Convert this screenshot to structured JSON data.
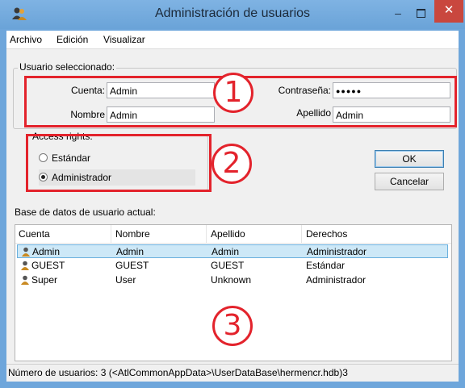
{
  "window": {
    "title": "Administración de usuarios",
    "minimize_glyph": "–",
    "close_glyph": "✕",
    "icon": "users-app-icon"
  },
  "menu": [
    "Archivo",
    "Edición",
    "Visualizar"
  ],
  "selected_user": {
    "legend": "Usuario seleccionado:",
    "account_label": "Cuenta:",
    "account_value": "Admin",
    "name_label": "Nombre",
    "name_value": "Admin",
    "password_label": "Contraseña:",
    "password_value": "●●●●●",
    "surname_label": "Apellido",
    "surname_value": "Admin"
  },
  "access_rights": {
    "legend": "Access rights:",
    "options": [
      "Estándar",
      "Administrador"
    ],
    "selected_index": 1
  },
  "buttons": {
    "ok": "OK",
    "cancel": "Cancelar"
  },
  "database": {
    "label": "Base de datos de usuario actual:",
    "columns": [
      "Cuenta",
      "Nombre",
      "Apellido",
      "Derechos"
    ],
    "rows": [
      [
        "Admin",
        "Admin",
        "Admin",
        "Administrador"
      ],
      [
        "GUEST",
        "GUEST",
        "GUEST",
        "Estándar"
      ],
      [
        "Super",
        "User",
        "Unknown",
        "Administrador"
      ]
    ],
    "selected_row": 0
  },
  "status": "Número de usuarios: 3  (<AtlCommonAppData>\\UserDataBase\\hermencr.hdb)3",
  "markers": [
    "1",
    "2",
    "3"
  ],
  "colors": {
    "titlebar": "#6ea6db",
    "close": "#c9473e",
    "annotation": "#e3232c",
    "selection": "#cde8f7"
  }
}
